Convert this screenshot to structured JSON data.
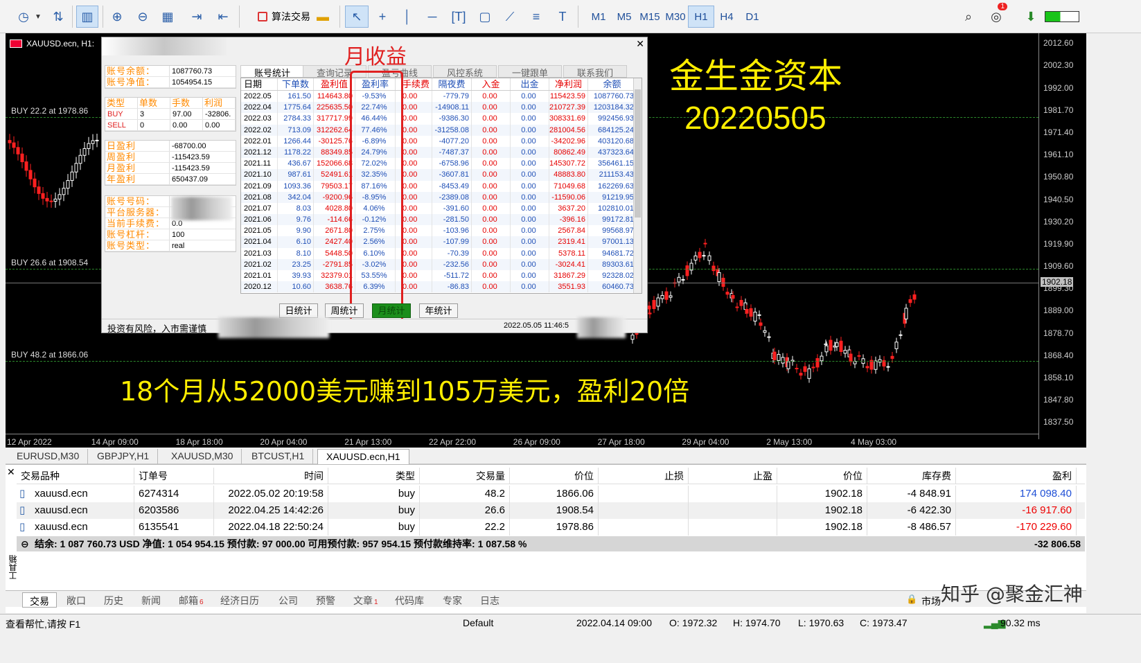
{
  "toolbar": {
    "algo_label": "算法交易",
    "timeframes": [
      "M1",
      "M5",
      "M15",
      "M30",
      "H1",
      "H4",
      "D1"
    ],
    "active_timeframe": "H1",
    "notification_count": "1"
  },
  "chart": {
    "title": "XAUUSD.ecn, H1:",
    "brand_line1": "金生金资本",
    "brand_line2": "20220505",
    "big_message": "18个月从52000美元赚到105万美元，盈利20倍",
    "price_ticks": [
      "2012.60",
      "2002.30",
      "1992.00",
      "1981.70",
      "1971.40",
      "1961.10",
      "1950.80",
      "1940.50",
      "1930.20",
      "1919.90",
      "1909.60",
      "1899.30",
      "1889.00",
      "1878.70",
      "1868.40",
      "1858.10",
      "1847.80",
      "1837.50"
    ],
    "current_price": "1902.18",
    "time_ticks": [
      "12 Apr 2022",
      "14 Apr 09:00",
      "18 Apr 18:00",
      "20 Apr 04:00",
      "21 Apr 13:00",
      "22 Apr 22:00",
      "26 Apr 09:00",
      "27 Apr 18:00",
      "29 Apr 04:00",
      "2 May 13:00",
      "4 May 03:00"
    ],
    "buy_lines": [
      {
        "label": "BUY 22.2 at 1978.86",
        "price": 1978.86
      },
      {
        "label": "BUY 26.6 at 1908.54",
        "price": 1908.54
      },
      {
        "label": "BUY 48.2 at 1866.06",
        "price": 1866.06
      }
    ],
    "colors": {
      "bull": "#ffffff",
      "bear": "#ff2020",
      "text": "#ffee00"
    }
  },
  "panel": {
    "summary1": [
      {
        "k": "账号余额：",
        "v": "1087760.73"
      },
      {
        "k": "账号净值：",
        "v": "1054954.15"
      }
    ],
    "positions_head": [
      "类型",
      "单数",
      "手数",
      "利润"
    ],
    "positions": [
      {
        "type": "BUY",
        "count": "3",
        "lots": "97.00",
        "profit": "-32806."
      },
      {
        "type": "SELL",
        "count": "0",
        "lots": "0.00",
        "profit": "0.00"
      }
    ],
    "profits": [
      {
        "k": "日盈利",
        "v": "-68700.00"
      },
      {
        "k": "周盈利",
        "v": "-115423.59"
      },
      {
        "k": "月盈利",
        "v": "-115423.59"
      },
      {
        "k": "年盈利",
        "v": "650437.09"
      }
    ],
    "account": [
      {
        "k": "账号号码：",
        "v": ""
      },
      {
        "k": "平台服务器：",
        "v": ""
      },
      {
        "k": "当前手续费：",
        "v": "0.0"
      },
      {
        "k": "账号杠杆：",
        "v": "100"
      },
      {
        "k": "账号类型：",
        "v": "real"
      }
    ],
    "tabs": [
      "账号统计",
      "查询记录",
      "盈亏曲线",
      "风控系统",
      "一键跟单",
      "联系我们"
    ],
    "annotation": "月收益",
    "columns": [
      "日期",
      "下单数",
      "盈利值",
      "盈利率",
      "手续费",
      "隔夜费",
      "入金",
      "出金",
      "净利润",
      "余额"
    ],
    "rows": [
      [
        "2022.05",
        "161.50",
        "114643.80",
        "-9.53%",
        "0.00",
        "-779.79",
        "0.00",
        "0.00",
        "115423.59",
        "1087760.73"
      ],
      [
        "2022.04",
        "1775.64",
        "225635.50",
        "22.74%",
        "0.00",
        "-14908.11",
        "0.00",
        "0.00",
        "210727.39",
        "1203184.32"
      ],
      [
        "2022.03",
        "2784.33",
        "317717.99",
        "46.44%",
        "0.00",
        "-9386.30",
        "0.00",
        "0.00",
        "308331.69",
        "992456.93"
      ],
      [
        "2022.02",
        "713.09",
        "312262.64",
        "77.46%",
        "0.00",
        "-31258.08",
        "0.00",
        "0.00",
        "281004.56",
        "684125.24"
      ],
      [
        "2022.01",
        "1266.44",
        "-30125.76",
        "-6.89%",
        "0.00",
        "-4077.20",
        "0.00",
        "0.00",
        "-34202.96",
        "403120.68"
      ],
      [
        "2021.12",
        "1178.22",
        "88349.85",
        "24.79%",
        "0.00",
        "-7487.37",
        "0.00",
        "0.00",
        "80862.49",
        "437323.64"
      ],
      [
        "2021.11",
        "436.67",
        "152066.68",
        "72.02%",
        "0.00",
        "-6758.96",
        "0.00",
        "0.00",
        "145307.72",
        "356461.15"
      ],
      [
        "2021.10",
        "987.61",
        "52491.61",
        "32.35%",
        "0.00",
        "-3607.81",
        "0.00",
        "0.00",
        "48883.80",
        "211153.43"
      ],
      [
        "2021.09",
        "1093.36",
        "79503.17",
        "87.16%",
        "0.00",
        "-8453.49",
        "0.00",
        "0.00",
        "71049.68",
        "162269.63"
      ],
      [
        "2021.08",
        "342.04",
        "-9200.96",
        "-8.95%",
        "0.00",
        "-2389.08",
        "0.00",
        "0.00",
        "-11590.06",
        "91219.95"
      ],
      [
        "2021.07",
        "8.03",
        "4028.80",
        "4.06%",
        "0.00",
        "-391.60",
        "0.00",
        "0.00",
        "3637.20",
        "102810.01"
      ],
      [
        "2021.06",
        "9.76",
        "-114.66",
        "-0.12%",
        "0.00",
        "-281.50",
        "0.00",
        "0.00",
        "-396.16",
        "99172.81"
      ],
      [
        "2021.05",
        "9.90",
        "2671.80",
        "2.75%",
        "0.00",
        "-103.96",
        "0.00",
        "0.00",
        "2567.84",
        "99568.97"
      ],
      [
        "2021.04",
        "6.10",
        "2427.40",
        "2.56%",
        "0.00",
        "-107.99",
        "0.00",
        "0.00",
        "2319.41",
        "97001.13"
      ],
      [
        "2021.03",
        "8.10",
        "5448.50",
        "6.10%",
        "0.00",
        "-70.39",
        "0.00",
        "0.00",
        "5378.11",
        "94681.72"
      ],
      [
        "2021.02",
        "23.25",
        "-2791.85",
        "-3.02%",
        "0.00",
        "-232.56",
        "0.00",
        "0.00",
        "-3024.41",
        "89303.61"
      ],
      [
        "2021.01",
        "39.93",
        "32379.01",
        "53.55%",
        "0.00",
        "-511.72",
        "0.00",
        "0.00",
        "31867.29",
        "92328.02"
      ],
      [
        "2020.12",
        "10.60",
        "3638.76",
        "6.39%",
        "0.00",
        "-86.83",
        "0.00",
        "0.00",
        "3551.93",
        "60460.73"
      ]
    ],
    "period_buttons": [
      "日统计",
      "周统计",
      "月统计",
      "年统计"
    ],
    "active_period": "月统计",
    "risk_text": "投资有风险，入市需谨慎",
    "timestamp": "2022.05.05 11:46:5"
  },
  "symbol_tabs": [
    "EURUSD,M30",
    "GBPJPY,H1",
    "XAUUSD,M30",
    "BTCUST,H1",
    "XAUUSD.ecn,H1"
  ],
  "active_symbol": "XAUUSD.ecn,H1",
  "terminal": {
    "columns": [
      "交易品种",
      "订单号",
      "时间",
      "类型",
      "交易量",
      "价位",
      "止损",
      "止盈",
      "价位",
      "库存费",
      "盈利"
    ],
    "orders": [
      {
        "symbol": "xauusd.ecn",
        "order": "6274314",
        "time": "2022.05.02 20:19:58",
        "type": "buy",
        "volume": "48.2",
        "price": "1866.06",
        "sl": "",
        "tp": "",
        "cur": "1902.18",
        "swap": "-4 848.91",
        "profit": "174 098.40"
      },
      {
        "symbol": "xauusd.ecn",
        "order": "6203586",
        "time": "2022.04.25 14:42:26",
        "type": "buy",
        "volume": "26.6",
        "price": "1908.54",
        "sl": "",
        "tp": "",
        "cur": "1902.18",
        "swap": "-6 422.30",
        "profit": "-16 917.60"
      },
      {
        "symbol": "xauusd.ecn",
        "order": "6135541",
        "time": "2022.04.18 22:50:24",
        "type": "buy",
        "volume": "22.2",
        "price": "1978.86",
        "sl": "",
        "tp": "",
        "cur": "1902.18",
        "swap": "-8 486.57",
        "profit": "-170 229.60"
      }
    ],
    "summary": "结余: 1 087 760.73 USD  净值: 1 054 954.15  预付款: 97 000.00  可用预付款: 957 954.15  预付款维持率: 1 087.58 %",
    "summary_profit": "-32 806.58",
    "side_label": "工具箱"
  },
  "bottom_tabs": [
    {
      "label": "交易",
      "badge": ""
    },
    {
      "label": "敞口",
      "badge": ""
    },
    {
      "label": "历史",
      "badge": ""
    },
    {
      "label": "新闻",
      "badge": ""
    },
    {
      "label": "邮箱",
      "badge": "6"
    },
    {
      "label": "经济日历",
      "badge": ""
    },
    {
      "label": "公司",
      "badge": ""
    },
    {
      "label": "预警",
      "badge": ""
    },
    {
      "label": "文章",
      "badge": "1"
    },
    {
      "label": "代码库",
      "badge": ""
    },
    {
      "label": "专家",
      "badge": ""
    },
    {
      "label": "日志",
      "badge": ""
    }
  ],
  "market_label": "市场",
  "watermark": "知乎 @聚金汇神",
  "status": {
    "help": "查看帮忙,请按 F1",
    "profile": "Default",
    "datetime": "2022.04.14 09:00",
    "open": "O: 1972.32",
    "high": "H: 1974.70",
    "low": "L: 1970.63",
    "close": "C: 1973.47",
    "ping": "90.32 ms"
  }
}
